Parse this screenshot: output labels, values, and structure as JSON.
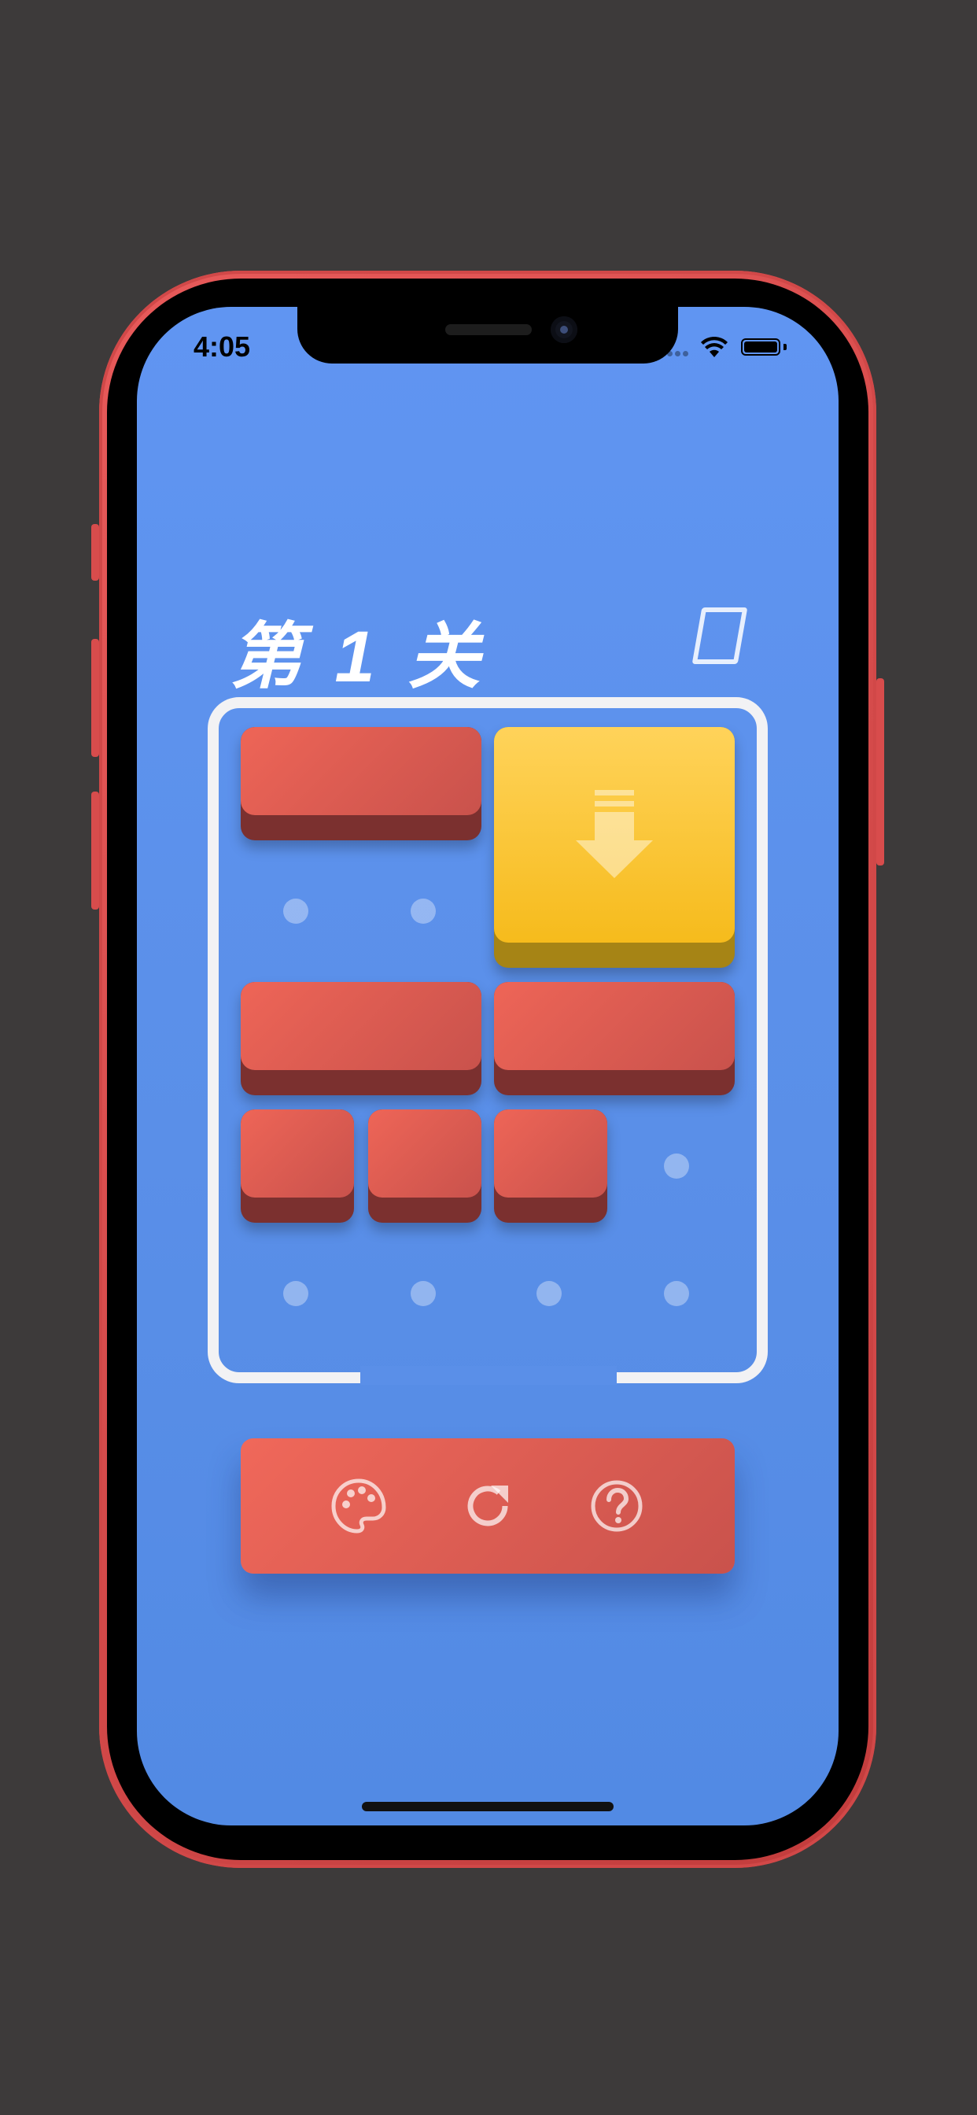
{
  "status_bar": {
    "time": "4:05",
    "icons": [
      "cellular-signal-icon",
      "wifi-icon",
      "battery-icon"
    ]
  },
  "game": {
    "level_title": "第 1 关",
    "settings_icon": "settings-glyph-icon",
    "target_block_icon": "down-arrow-icon",
    "board_rows": 5,
    "board_cols": 4
  },
  "toolbar": {
    "buttons": [
      {
        "icon": "palette-icon"
      },
      {
        "icon": "restart-icon"
      },
      {
        "icon": "help-icon"
      }
    ]
  },
  "colors": {
    "background": "#3d3a3a",
    "screen": "#5a8fe8",
    "block_red": "#e0594f",
    "block_yellow": "#f9c32c",
    "board_border": "#f2f2f4"
  }
}
